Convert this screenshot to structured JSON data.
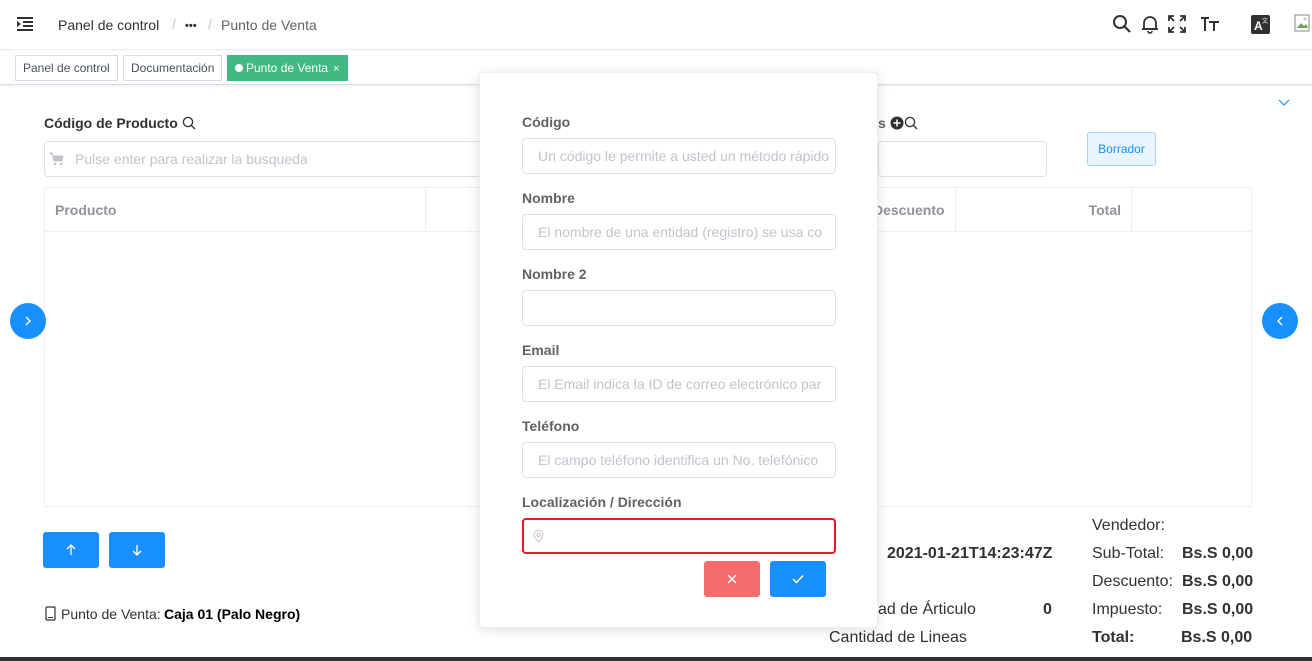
{
  "header": {
    "breadcrumb": [
      "Panel de control",
      "•••",
      "Punto de Venta"
    ],
    "separator": "/",
    "icons": [
      "menu-toggle-icon",
      "search-icon",
      "bell-icon",
      "fullscreen-icon",
      "font-size-icon",
      "translate-icon",
      "avatar-image"
    ]
  },
  "tags": [
    {
      "label": "Panel de control"
    },
    {
      "label": "Documentación"
    },
    {
      "label": "Punto de Venta",
      "close": "×"
    }
  ],
  "main": {
    "product_code_label": "Código de Producto",
    "product_search_placeholder": "Pulse enter para realizar la busqueda",
    "partner_label_partial": "s",
    "draft_button": "Borrador",
    "columns": [
      "Producto",
      "Descuento",
      "Total"
    ],
    "pos_label": "Punto de Venta:",
    "pos_value": "Caja 01 (Palo Negro)",
    "date": "2021-01-21T14:23:47Z",
    "qty_articles_label": "ad de Árticulo",
    "qty_articles_value": "0",
    "qty_lines_label": "Cantidad de Lineas"
  },
  "totals": {
    "seller_label": "Vendedor:",
    "subtotal_label": "Sub-Total:",
    "subtotal_value": "Bs.S 0,00",
    "discount_label": "Descuento:",
    "discount_value": "Bs.S 0,00",
    "tax_label": "Impuesto:",
    "tax_value": "Bs.S 0,00",
    "total_label": "Total:",
    "total_value": "Bs.S 0,00"
  },
  "modal": {
    "fields": [
      {
        "label": "Código",
        "placeholder": "Un código le permite a usted un método rápido"
      },
      {
        "label": "Nombre",
        "placeholder": "El nombre de una entidad (registro) se usa co"
      },
      {
        "label": "Nombre 2",
        "placeholder": ""
      },
      {
        "label": "Email",
        "placeholder": "El Email indica la ID de correo electrónico par"
      },
      {
        "label": "Teléfono",
        "placeholder": "El campo teléfono identifica un No. telefónico"
      },
      {
        "label": "Localización / Dirección",
        "placeholder": ""
      }
    ]
  },
  "colors": {
    "primary": "#1890ff",
    "active_tag": "#42b983",
    "danger": "#f56c6c",
    "error_border": "#e01b24"
  }
}
